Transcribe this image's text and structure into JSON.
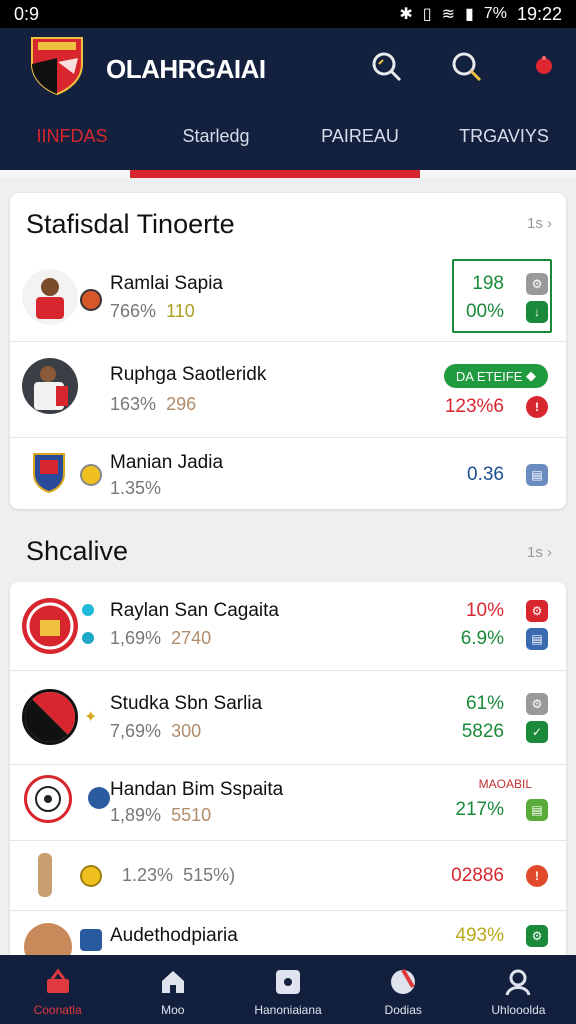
{
  "status": {
    "left": "0:9",
    "right_icons": [
      "bluetooth-icon",
      "vibrate-icon",
      "wifi-icon",
      "signal-icon"
    ],
    "battery": "7%",
    "time": "19:22"
  },
  "header": {
    "title": "OLAHRGAIAI"
  },
  "tabs": [
    {
      "label": "IINFDAS",
      "active": true
    },
    {
      "label": "Starledg",
      "active": false
    },
    {
      "label": "PAIREAU",
      "active": false
    },
    {
      "label": "TRGAVIYS",
      "active": false
    }
  ],
  "card1": {
    "title": "Stafisdal Tinoerte",
    "more": "1s ›",
    "rows": [
      {
        "name": "Ramlai Sapia",
        "stat1": "766%",
        "stat2": "110",
        "value_top": "198",
        "value_bottom": "00%",
        "top_color": "#1a8a3a",
        "bottom_color": "#1a8a3a"
      },
      {
        "name": "Ruphga Saotleridk",
        "stat1": "163%",
        "stat2": "296",
        "badge": "DA ETEIFE",
        "value_bottom": "123%6",
        "bottom_color": "#d8262e"
      },
      {
        "name": "Manian Jadia",
        "stat1": "1.35%",
        "value_bottom": "0.36",
        "bottom_color": "#1d4f8f"
      }
    ]
  },
  "section2": {
    "title": "Shcalive",
    "more": "1s ›",
    "rows": [
      {
        "name": "Raylan San Cagaita",
        "stat1": "1,69%",
        "stat2": "2740",
        "value_top": "10%",
        "value_bottom": "6.9%",
        "top_color": "#d8262e",
        "bottom_color": "#1a8a3a"
      },
      {
        "name": "Studka Sbn Sarlia",
        "stat1": "7,69%",
        "stat2": "300",
        "value_top": "61%",
        "value_bottom": "5826",
        "top_color": "#1a8a3a",
        "bottom_color": "#1a8a3a"
      },
      {
        "name": "Handan Bim Sspaita",
        "stat1": "1,89%",
        "stat2": "5510",
        "label_top": "MAOABIL",
        "value_bottom": "217%",
        "bottom_color": "#1a8a3a"
      },
      {
        "stat1": "1.23%",
        "stat2": "515%)",
        "value_bottom": "02886",
        "bottom_color": "#d8262e"
      },
      {
        "name": "Audethodpiaria",
        "value_top": "493%",
        "top_color": "#b8a81a"
      }
    ]
  },
  "nav": [
    {
      "label": "Coonatla",
      "icon": "basket-icon",
      "active": true
    },
    {
      "label": "Moo",
      "icon": "home-icon",
      "active": false
    },
    {
      "label": "Hanoniaiana",
      "icon": "camera-icon",
      "active": false
    },
    {
      "label": "Dodias",
      "icon": "ball-icon",
      "active": false
    },
    {
      "label": "Uhlooolda",
      "icon": "user-icon",
      "active": false
    }
  ],
  "colors": {
    "navy": "#13213f",
    "accent_red": "#d8262e",
    "green": "#1a8a3a"
  }
}
